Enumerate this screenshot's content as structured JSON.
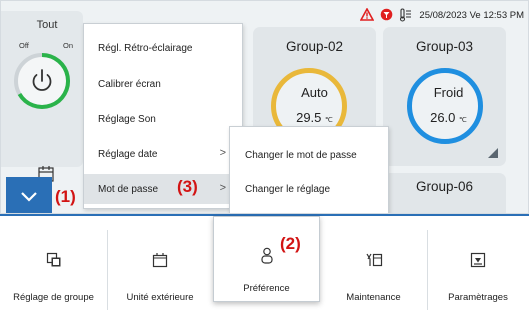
{
  "status": {
    "datetime": "25/08/2023 Ve 12:53 PM",
    "icons": [
      "warning-icon",
      "filter-icon",
      "thermometer-icon"
    ],
    "warning_color": "#e02020"
  },
  "tout": {
    "title": "Tout",
    "off": "Off",
    "on": "On",
    "accent": "#2ab34a"
  },
  "groups": [
    {
      "name": "Group-02",
      "mode": "Auto",
      "temp": "29.5",
      "unit": "℃",
      "color": "#e9b83a"
    },
    {
      "name": "Group-03",
      "mode": "Froid",
      "temp": "26.0",
      "unit": "℃",
      "color": "#1f8fe0"
    },
    {
      "name": "Group-06"
    }
  ],
  "menu": {
    "items": [
      {
        "label": "Régl. Rétro-éclairage"
      },
      {
        "label": "Calibrer écran"
      },
      {
        "label": "Réglage Son"
      },
      {
        "label": "Réglage date",
        "chevron": ">"
      },
      {
        "label": "Mot de passe",
        "chevron": ">"
      }
    ]
  },
  "submenu": {
    "items": [
      {
        "label": "Changer le mot de passe"
      },
      {
        "label": "Changer le réglage"
      }
    ]
  },
  "callouts": {
    "c1": "(1)",
    "c2": "(2)",
    "c3": "(3)",
    "color": "#d21414"
  },
  "toolbar": {
    "accent": "#2a6fb6",
    "buttons": [
      {
        "label": "Réglage de groupe",
        "icon": "group-settings-icon"
      },
      {
        "label": "Unité extérieure",
        "icon": "outdoor-unit-icon"
      },
      {
        "label": "Préférence",
        "icon": "preference-icon"
      },
      {
        "label": "Maintenance",
        "icon": "maintenance-icon"
      },
      {
        "label": "Paramètrages",
        "icon": "download-icon"
      }
    ]
  }
}
